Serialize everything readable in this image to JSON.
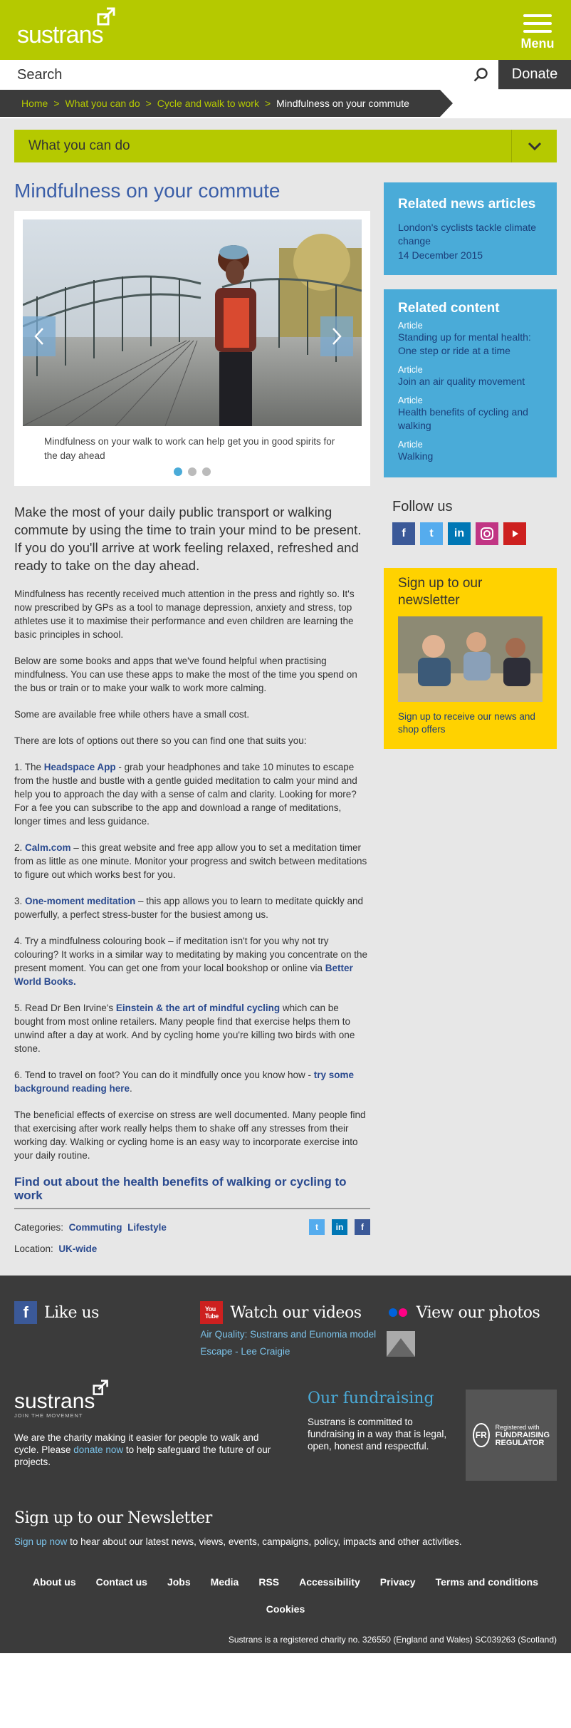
{
  "header": {
    "logo_text": "sustrans",
    "menu_label": "Menu",
    "search_placeholder": "Search",
    "donate_label": "Donate"
  },
  "breadcrumb": {
    "items": [
      "Home",
      "What you can do",
      "Cycle and walk to work"
    ],
    "current": "Mindfulness on your commute"
  },
  "section_nav": {
    "label": "What you can do"
  },
  "article": {
    "title": "Mindfulness on your commute",
    "caption": "Mindfulness on your walk to work can help get you in good spirits for the day ahead",
    "lede": "Make the most of your daily public transport or walking commute by using the time to train your mind to be present. If you do you'll arrive at work feeling relaxed, refreshed and ready to take on the day ahead.",
    "p1": "Mindfulness has recently received much attention in the press and rightly so. It's now prescribed by GPs as a tool to manage depression, anxiety and stress, top athletes use it to maximise their performance and even children are learning the basic principles in school.",
    "p2": "Below are some books and apps that we've found helpful when practising mindfulness. You can use these apps to make the most of the time you spend on the bus or train or to make your walk to work more calming.",
    "p3": "Some are available free while others have a small cost.",
    "p4": "There are lots of options out there so you can find one that suits you:",
    "item1_prefix": "1. The ",
    "item1_link": "Headspace App",
    "item1_text": " - grab your headphones and take 10 minutes to escape from the hustle and bustle with a gentle guided meditation to calm your mind and help you to approach the day with a sense of calm and clarity. Looking for more? For a fee you can subscribe to the app and download a range of meditations, longer times and less guidance.",
    "item2_prefix": "2. ",
    "item2_link": "Calm.com",
    "item2_text": " – this great website and free app allow you to set a meditation timer from as little as one minute. Monitor your progress and switch between meditations to figure out which works best for you.",
    "item3_prefix": "3. ",
    "item3_link": "One-moment meditation",
    "item3_text": " – this app allows you to learn to meditate quickly and powerfully, a perfect stress-buster for the busiest among us.",
    "item4_text": "4. Try a mindfulness colouring book – if meditation isn't for you why not try colouring? It works in a similar way to meditating by making you concentrate on the present moment.  You can get one from your local bookshop or online via ",
    "item4_link": "Better World Books.",
    "item5_prefix": "5. Read Dr Ben Irvine's ",
    "item5_link": "Einstein & the art of mindful cycling",
    "item5_text": " which can be bought from most online retailers. Many people find that exercise helps them to unwind after a day at work. And by cycling home you're killing two birds with one stone.",
    "item6_text": "6. Tend to travel on foot? You can do it mindfully once you know how - ",
    "item6_link": "try some background reading here",
    "item6_end": ".",
    "p5": "The beneficial effects of exercise on stress are well documented. Many people find that exercising after work really helps them to shake off any stresses from their working day. Walking or cycling home is an easy way to incorporate exercise into your daily routine.",
    "find_out": "Find out about the health benefits of walking or cycling to work",
    "categories_label": "Categories:",
    "categories": [
      "Commuting",
      "Lifestyle"
    ],
    "location_label": "Location:",
    "location": "UK-wide"
  },
  "sidebar": {
    "related_news_title": "Related news articles",
    "news_link": "London's cyclists tackle climate change",
    "news_date": "14 December 2015",
    "related_content_title": "Related content",
    "related_content": [
      {
        "type": "Article",
        "title": "Standing up for mental health: One step or ride at a time"
      },
      {
        "type": "Article",
        "title": "Join an air quality movement"
      },
      {
        "type": "Article",
        "title": "Health benefits of cycling and walking"
      },
      {
        "type": "Article",
        "title": "Walking"
      }
    ],
    "follow_title": "Follow us",
    "newsletter_title": "Sign up to our newsletter",
    "newsletter_link": "Sign up to receive our news and shop offers"
  },
  "footer": {
    "like_us": "Like us",
    "watch_videos": "Watch our videos",
    "videos": [
      "Air Quality: Sustrans and Eunomia model",
      "Escape - Lee Craigie"
    ],
    "view_photos": "View our photos",
    "logo_text": "sustrans",
    "logo_sub": "JOIN THE MOVEMENT",
    "charity_text_1": "We are the charity making it easier for people to walk and cycle. Please ",
    "charity_link": "donate now",
    "charity_text_2": " to help safeguard the future of our projects.",
    "fundraising_title": "Our fundraising",
    "fundraising_text": "Sustrans is committed to fundraising in a way that is legal, open, honest and respectful.",
    "fr_badge_line1": "Registered with",
    "fr_badge_line2": "FUNDRAISING",
    "fr_badge_line3": "REGULATOR",
    "fr_badge_mark": "FR",
    "newsletter_title": "Sign up to our Newsletter",
    "newsletter_link": "Sign up now",
    "newsletter_text": " to hear about our latest news, views, events, campaigns, policy, impacts and other activities.",
    "links": [
      "About us",
      "Contact us",
      "Jobs",
      "Media",
      "RSS",
      "Accessibility",
      "Privacy",
      "Terms and conditions"
    ],
    "cookies": "Cookies",
    "legal": "Sustrans is a registered charity no. 326550 (England and Wales) SC039263 (Scotland)"
  },
  "colors": {
    "brand_green": "#b5c900",
    "dark_grey": "#3b3b3b",
    "sky_blue": "#4aabd8",
    "link_navy": "#2a4a8f",
    "newsletter_yellow": "#ffd200"
  }
}
